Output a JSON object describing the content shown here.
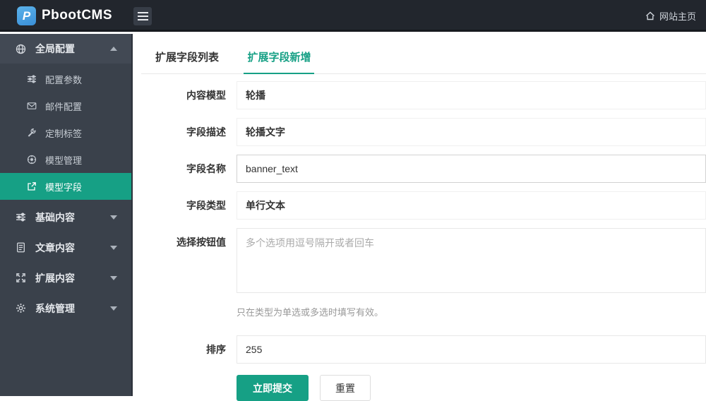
{
  "brand": {
    "logo_letter": "P",
    "title": "PbootCMS"
  },
  "topbar": {
    "home_label": "网站主页"
  },
  "sidebar": {
    "group_global": {
      "label": "全局配置",
      "icon": "globe-icon",
      "expanded": true
    },
    "sub_items": [
      {
        "label": "配置参数",
        "icon": "sliders-icon"
      },
      {
        "label": "邮件配置",
        "icon": "envelope-icon"
      },
      {
        "label": "定制标签",
        "icon": "wrench-icon"
      },
      {
        "label": "模型管理",
        "icon": "model-wheel-icon"
      },
      {
        "label": "模型字段",
        "icon": "external-link-icon",
        "active": true
      }
    ],
    "groups": [
      {
        "label": "基础内容",
        "icon": "sliders-icon"
      },
      {
        "label": "文章内容",
        "icon": "document-icon"
      },
      {
        "label": "扩展内容",
        "icon": "expand-icon"
      },
      {
        "label": "系统管理",
        "icon": "gear-icon"
      }
    ]
  },
  "tabs": {
    "list_label": "扩展字段列表",
    "add_label": "扩展字段新增"
  },
  "form": {
    "fields": [
      {
        "label": "内容模型",
        "value": "轮播"
      },
      {
        "label": "字段描述",
        "value": "轮播文字"
      },
      {
        "label": "字段名称",
        "value": "banner_text"
      },
      {
        "label": "字段类型",
        "value": "单行文本"
      },
      {
        "label": "选择按钮值",
        "placeholder": "多个选项用逗号隔开或者回车"
      },
      {
        "label": "排序",
        "value": "255"
      }
    ],
    "helper": "只在类型为单选或多选时填写有效。",
    "submit_label": "立即提交",
    "reset_label": "重置"
  },
  "colors": {
    "accent": "#16a085",
    "topbar_bg": "#22262d",
    "sidebar_bg": "#3a414b",
    "sidebar_group_open_bg": "#424954",
    "logo_blue": "#3a8fd8"
  }
}
